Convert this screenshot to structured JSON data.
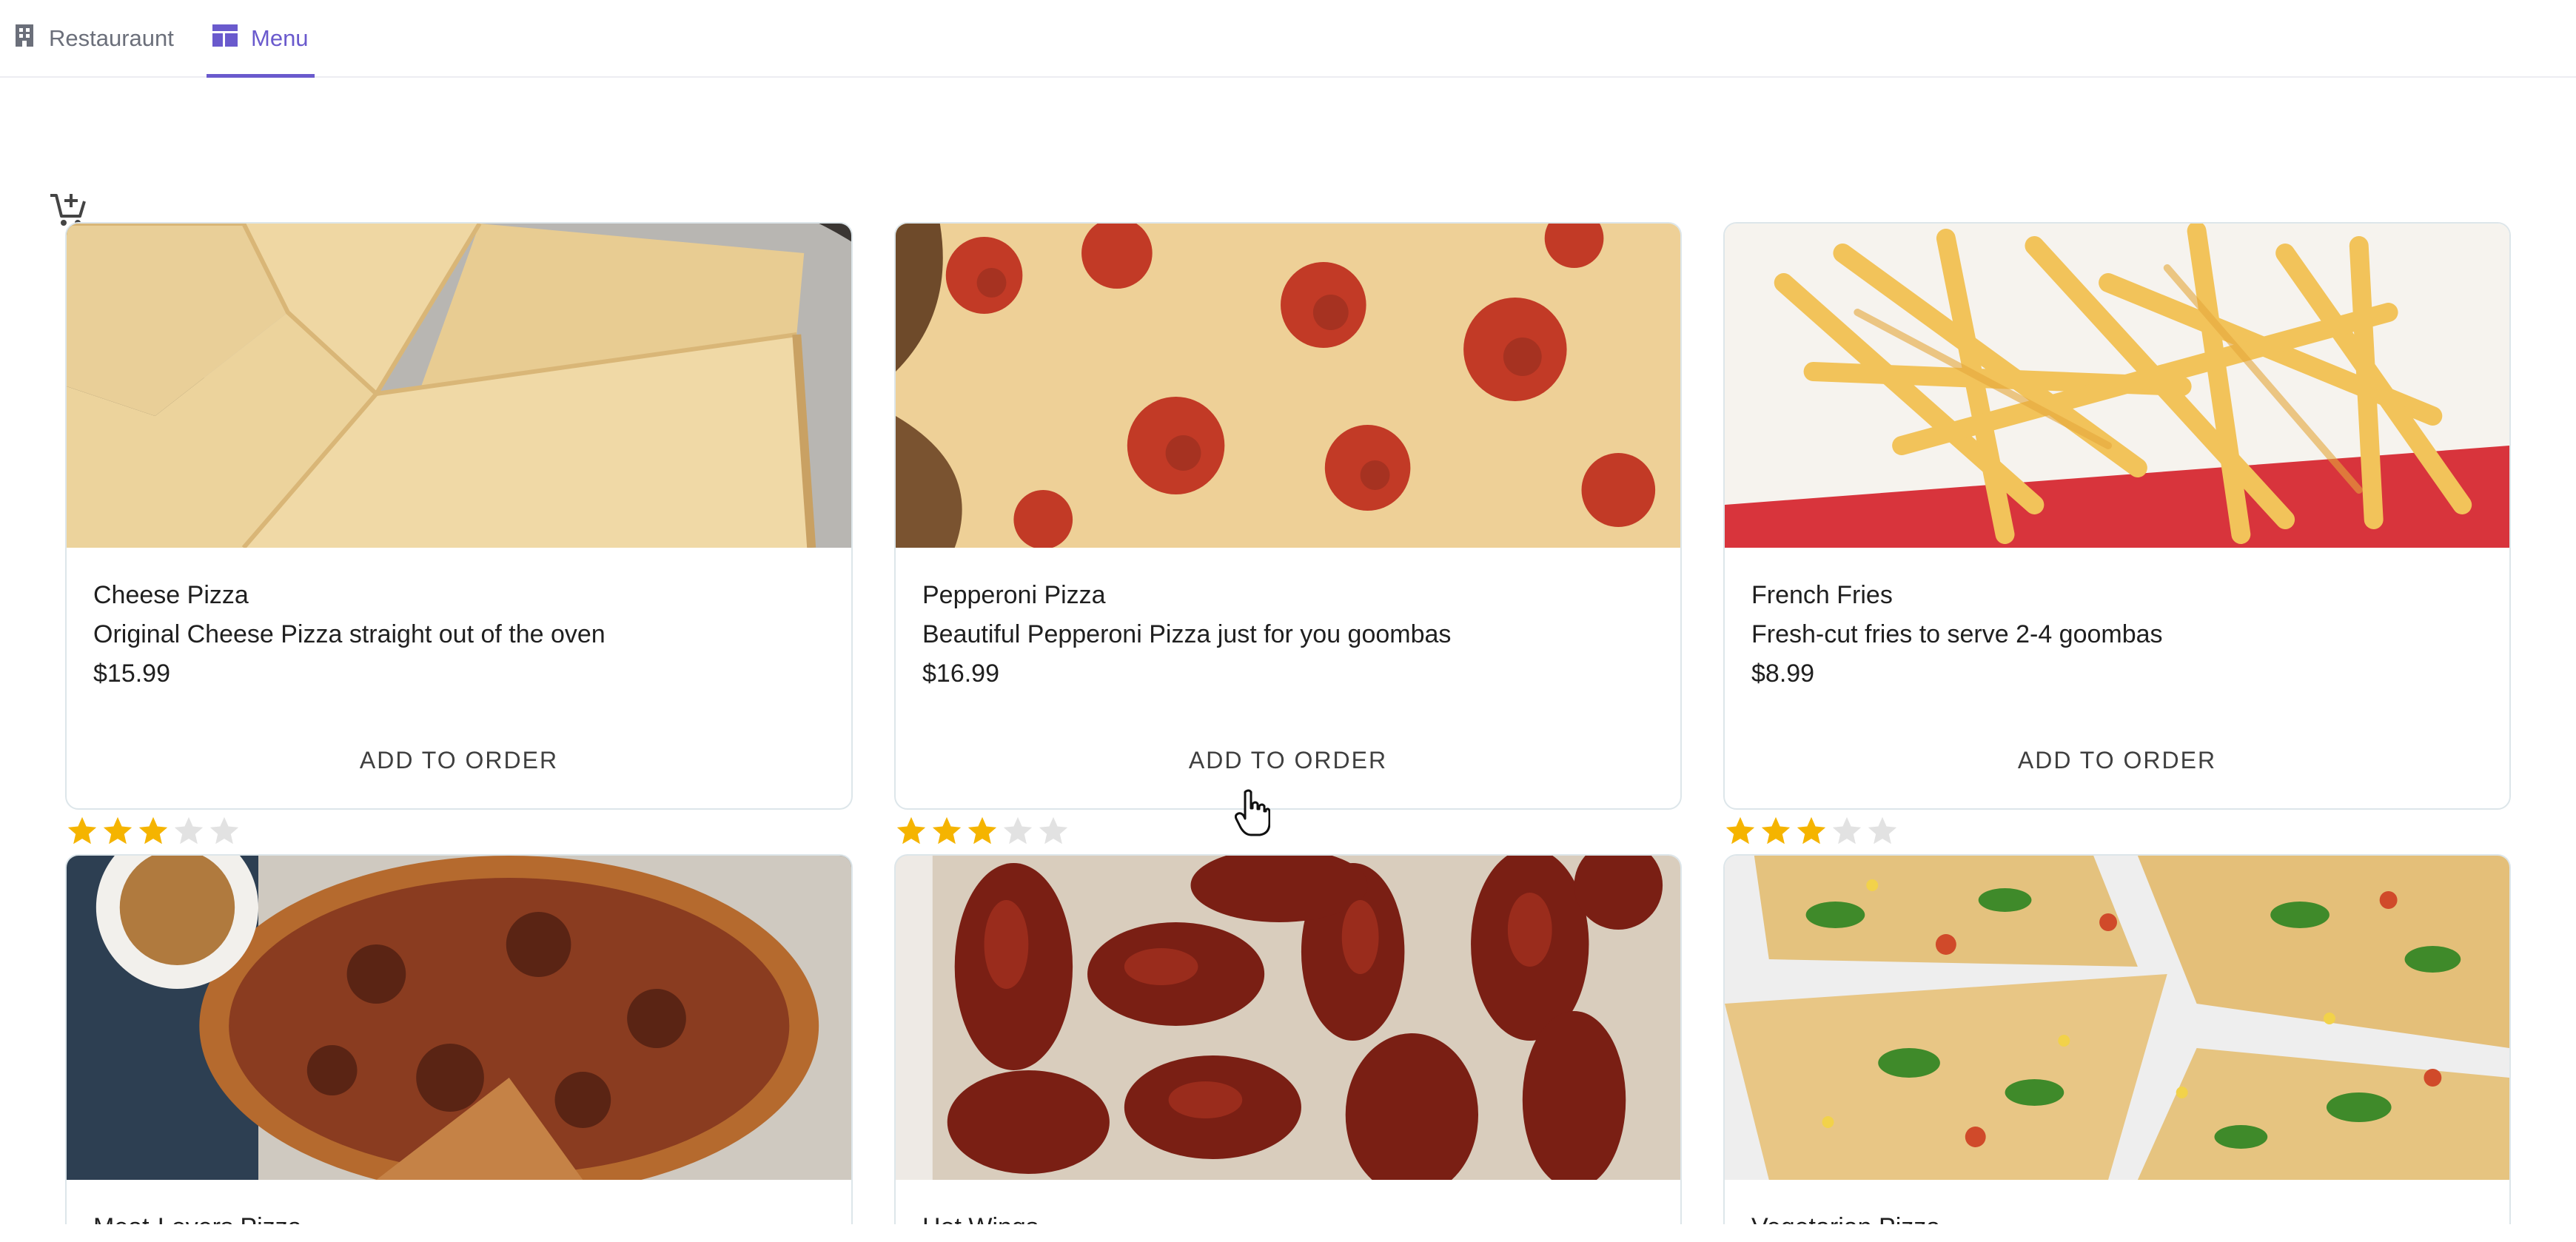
{
  "nav": {
    "tabs": [
      {
        "label": "Restauraunt",
        "icon": "building-icon",
        "active": false
      },
      {
        "label": "Menu",
        "icon": "dashboard-icon",
        "active": true
      }
    ],
    "accent_color": "#6a5acd"
  },
  "toolbar": {
    "cart_icon": "add-shopping-cart-icon"
  },
  "menu": {
    "items": [
      {
        "name": "Cheese Pizza",
        "description": "Original Cheese Pizza straight out of the oven",
        "price": "$15.99",
        "button": "ADD TO ORDER",
        "rating": 3,
        "rating_max": 5
      },
      {
        "name": "Pepperoni Pizza",
        "description": "Beautiful Pepperoni Pizza just for you goombas",
        "price": "$16.99",
        "button": "ADD TO ORDER",
        "rating": 3,
        "rating_max": 5
      },
      {
        "name": "French Fries",
        "description": "Fresh-cut fries to serve 2-4 goombas",
        "price": "$8.99",
        "button": "ADD TO ORDER",
        "rating": 3,
        "rating_max": 5
      },
      {
        "name": "Meat-Lovers Pizza"
      },
      {
        "name": "Hot Wings"
      },
      {
        "name": "Vegetarian Pizza"
      }
    ]
  },
  "colors": {
    "star_filled": "#f5b400",
    "star_empty": "#e2e2e2"
  }
}
